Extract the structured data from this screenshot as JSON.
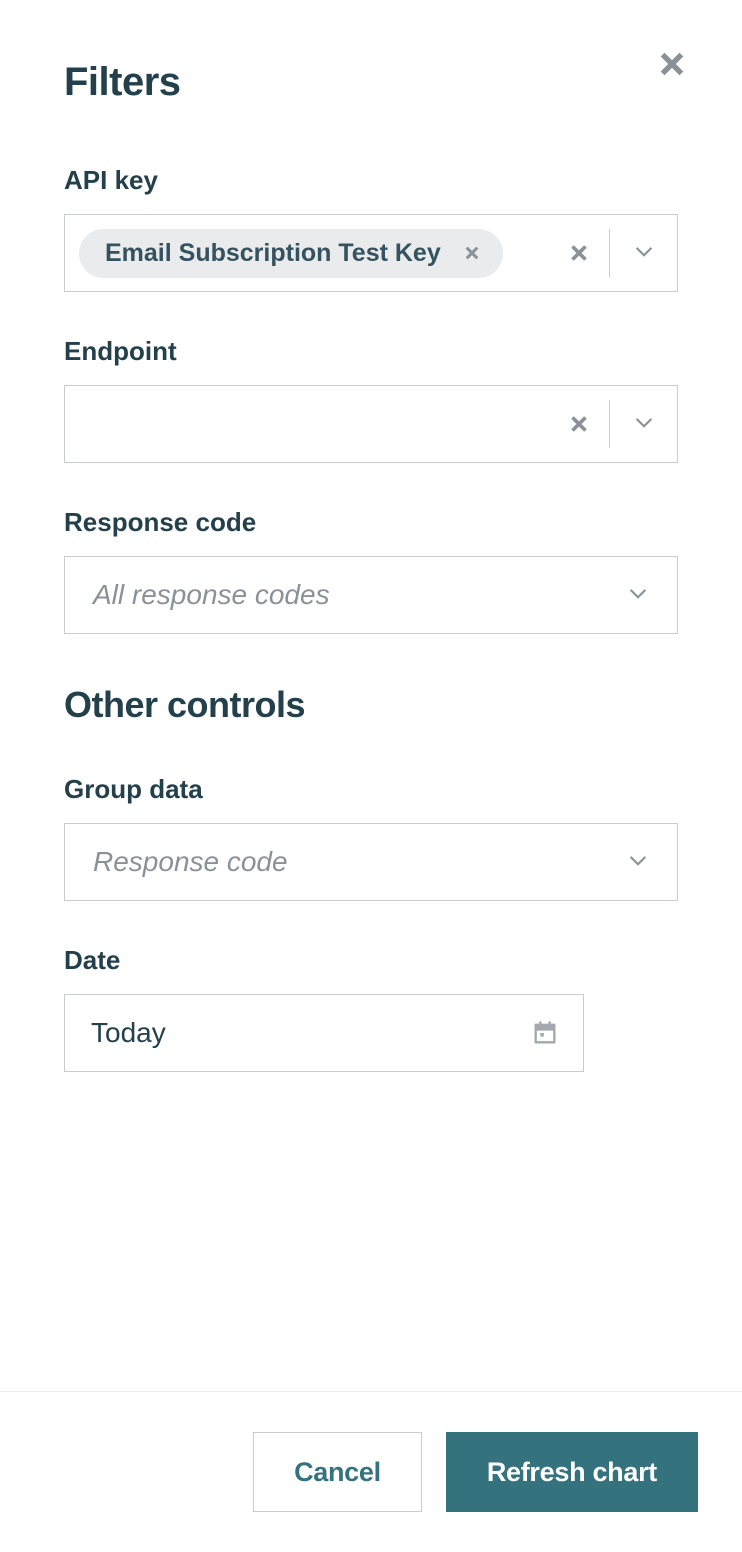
{
  "header": {
    "title": "Filters"
  },
  "filters": {
    "api_key": {
      "label": "API key",
      "selected_pill": "Email Subscription Test Key"
    },
    "endpoint": {
      "label": "Endpoint"
    },
    "response_code": {
      "label": "Response code",
      "placeholder": "All response codes"
    }
  },
  "other_controls": {
    "title": "Other controls",
    "group_data": {
      "label": "Group data",
      "placeholder": "Response code"
    },
    "date": {
      "label": "Date",
      "value": "Today"
    }
  },
  "footer": {
    "cancel": "Cancel",
    "refresh": "Refresh chart"
  }
}
